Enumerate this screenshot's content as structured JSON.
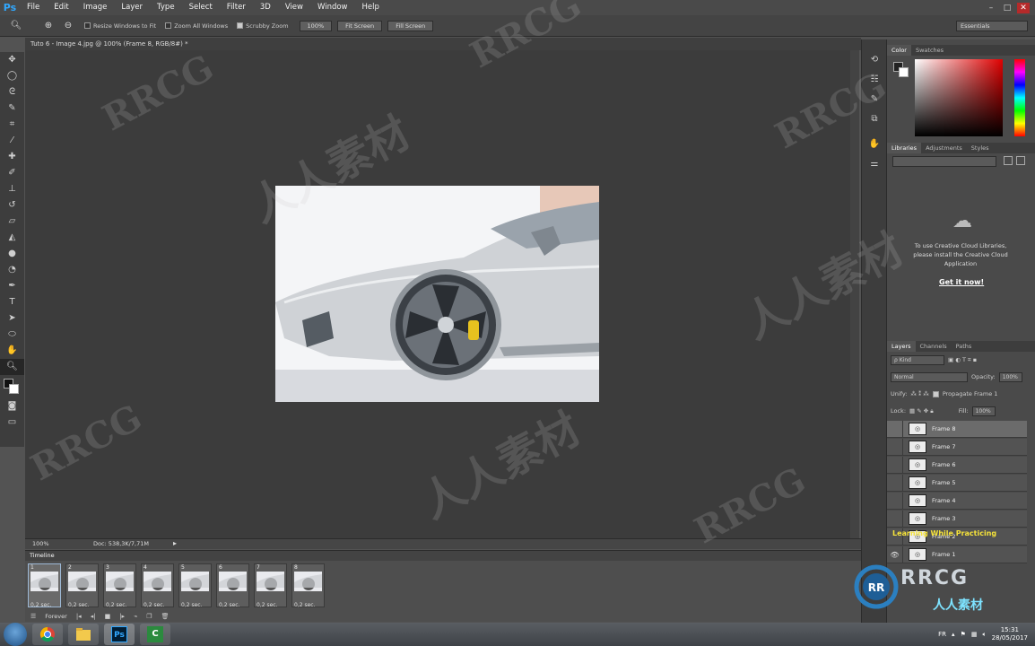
{
  "app": {
    "logo": "Ps",
    "menu": [
      "File",
      "Edit",
      "Image",
      "Layer",
      "Type",
      "Select",
      "Filter",
      "3D",
      "View",
      "Window",
      "Help"
    ],
    "window_controls": [
      "–",
      "□",
      "✕"
    ]
  },
  "options": {
    "resize_windows": "Resize Windows to Fit",
    "zoom_all": "Zoom All Windows",
    "scrubby_zoom": "Scrubby Zoom",
    "zoom_pct": "100%",
    "fit_screen": "Fit Screen",
    "fill_screen": "Fill Screen",
    "workspace": "Essentials"
  },
  "document": {
    "tab_title": "Tuto 6 - Image 4.jpg @ 100% (Frame 8, RGB/8#) *",
    "zoom": "100%",
    "doc_size": "Doc: 538,3K/7,71M"
  },
  "timeline": {
    "title": "Timeline",
    "frames": [
      {
        "num": "1",
        "delay": "0,2 sec."
      },
      {
        "num": "2",
        "delay": "0,2 sec."
      },
      {
        "num": "3",
        "delay": "0,2 sec."
      },
      {
        "num": "4",
        "delay": "0,2 sec."
      },
      {
        "num": "5",
        "delay": "0,2 sec."
      },
      {
        "num": "6",
        "delay": "0,2 sec."
      },
      {
        "num": "7",
        "delay": "0,2 sec."
      },
      {
        "num": "8",
        "delay": "0,2 sec."
      }
    ],
    "loop": "Forever"
  },
  "panels": {
    "color_tabs": [
      "Color",
      "Swatches"
    ],
    "lib_tabs": [
      "Libraries",
      "Adjustments",
      "Styles"
    ],
    "cc_message": "To use Creative Cloud Libraries, please install the Creative Cloud Application",
    "cc_link": "Get it now!",
    "layer_tabs": [
      "Layers",
      "Channels",
      "Paths"
    ],
    "kind": "ρ Kind",
    "blend_mode": "Normal",
    "opacity_label": "Opacity:",
    "opacity_value": "100%",
    "unify_label": "Unify:",
    "propagate": "Propagate Frame 1",
    "lock_label": "Lock:",
    "fill_label": "Fill:",
    "fill_value": "100%",
    "layers": [
      "Frame 8",
      "Frame 7",
      "Frame 6",
      "Frame 5",
      "Frame 4",
      "Frame 3",
      "Frame 2",
      "Frame 1"
    ]
  },
  "taskbar": {
    "lang": "FR",
    "time": "15:31",
    "date": "28/05/2017"
  },
  "watermark": {
    "brand": "RRCG",
    "cn": "人人素材",
    "tagline": "Learning While Practicing"
  },
  "colors": {
    "accent": "#31a8ff",
    "brake_caliper": "#e7c21f",
    "cc_brand": "#7ee3ff"
  }
}
